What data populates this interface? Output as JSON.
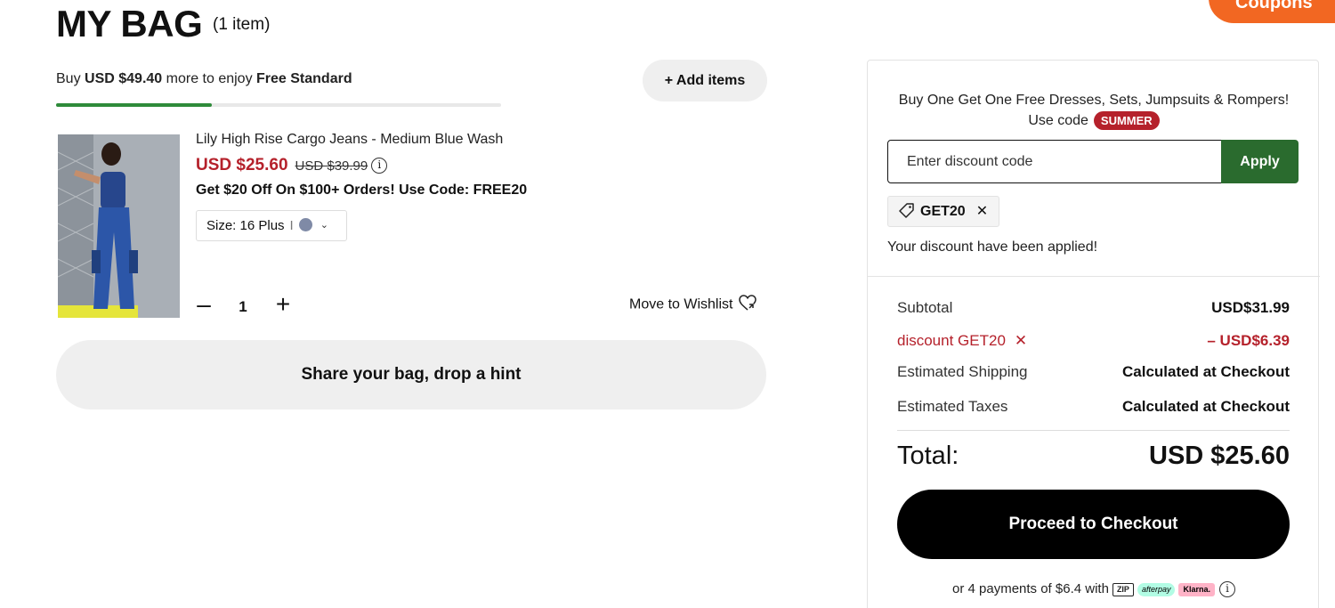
{
  "header": {
    "title": "MY BAG",
    "item_count": "(1 item)",
    "coupons_tab": "Coupons"
  },
  "shipping": {
    "prefix": "Buy ",
    "amount": "USD $49.40",
    "middle": " more to enjoy ",
    "reward": "Free Standard",
    "progress_fraction": 0.35
  },
  "add_items_label": "+ Add items",
  "product": {
    "name": "Lily High Rise Cargo Jeans - Medium Blue Wash",
    "sale_price": "USD $25.60",
    "original_price": "USD $39.99",
    "promo": "Get $20 Off On $100+ Orders! Use Code: FREE20",
    "size_label": "Size: 16 Plus",
    "size_separator": "I",
    "color": "#7f8aa6",
    "quantity": "1",
    "minus_glyph": "–",
    "plus_glyph": "+",
    "wishlist_label": "Move to Wishlist"
  },
  "share_label": "Share your bag, drop a hint",
  "summary": {
    "promo_line1": "Buy One Get One Free Dresses, Sets, Jumpsuits & Rompers!",
    "promo_line2_prefix": "Use code",
    "promo_code": "SUMMER",
    "discount_placeholder": "Enter discount code",
    "apply_label": "Apply",
    "applied_code": "GET20",
    "applied_message": "Your discount have been applied!",
    "rows": {
      "subtotal_label": "Subtotal",
      "subtotal_value": "USD$31.99",
      "discount_label": "discount GET20",
      "discount_value": "– USD$6.39",
      "shipping_label": "Estimated Shipping",
      "shipping_value": "Calculated at Checkout",
      "taxes_label": "Estimated Taxes",
      "taxes_value": "Calculated at Checkout"
    },
    "total_label": "Total:",
    "total_value": "USD $25.60",
    "checkout_label": "Proceed to Checkout",
    "installments_text": "or 4 payments of $6.4 with",
    "pay_zip": "ZIP",
    "pay_afterpay": "afterpay",
    "pay_klarna": "Klarna.",
    "accent_red": "#b5212b",
    "accent_green": "#2a6b2e"
  }
}
